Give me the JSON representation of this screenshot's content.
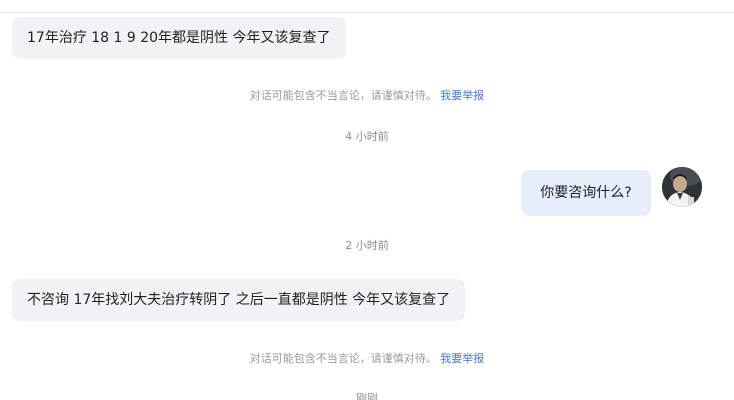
{
  "messages": [
    {
      "text": "17年治疗 18 1 9 20年都是阴性 今年又该复查了"
    },
    {
      "text": "你要咨询什么?"
    },
    {
      "text": "不咨询 17年找刘大夫治疗转阴了 之后一直都是阴性 今年又该复查了"
    }
  ],
  "notice": {
    "text": "对话可能包含不当言论，请谨慎对待。",
    "report_link": "我要举报"
  },
  "timestamps": [
    "4 小时前",
    "2 小时前",
    "刚刚"
  ],
  "colors": {
    "incoming_bubble": "#f1f2f4",
    "outgoing_bubble": "#e6eefb",
    "link": "#4a78c9"
  },
  "icons": {
    "avatar": "doctor-avatar"
  }
}
